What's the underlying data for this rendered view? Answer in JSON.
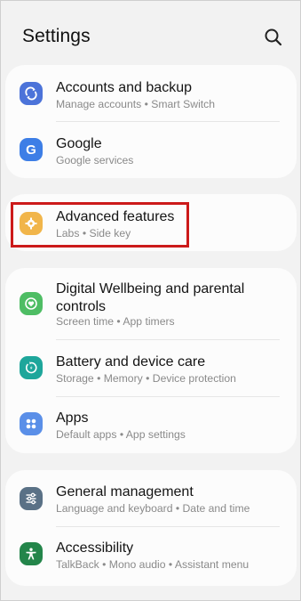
{
  "header": {
    "title": "Settings"
  },
  "items": [
    {
      "title": "Accounts and backup",
      "subtitle": "Manage accounts  •  Smart Switch",
      "icon": "sync-icon",
      "color": "#4c73d9"
    },
    {
      "title": "Google",
      "subtitle": "Google services",
      "icon": "google-icon",
      "color": "#3d7ee6"
    },
    {
      "title": "Advanced features",
      "subtitle": "Labs  •  Side key",
      "icon": "gear-plus-icon",
      "color": "#f1b54a"
    },
    {
      "title": "Digital Wellbeing and parental controls",
      "subtitle": "Screen time  •  App timers",
      "icon": "wellbeing-heart-icon",
      "color": "#4ebd64"
    },
    {
      "title": "Battery and device care",
      "subtitle": "Storage  •  Memory  •  Device protection",
      "icon": "device-care-icon",
      "color": "#1ea69b"
    },
    {
      "title": "Apps",
      "subtitle": "Default apps  •  App settings",
      "icon": "apps-grid-icon",
      "color": "#5a8fe8"
    },
    {
      "title": "General management",
      "subtitle": "Language and keyboard  •  Date and time",
      "icon": "sliders-icon",
      "color": "#5a7186"
    },
    {
      "title": "Accessibility",
      "subtitle": "TalkBack  •  Mono audio  •  Assistant menu",
      "icon": "accessibility-icon",
      "color": "#23854a"
    }
  ],
  "highlight_color": "#cc1a1a"
}
